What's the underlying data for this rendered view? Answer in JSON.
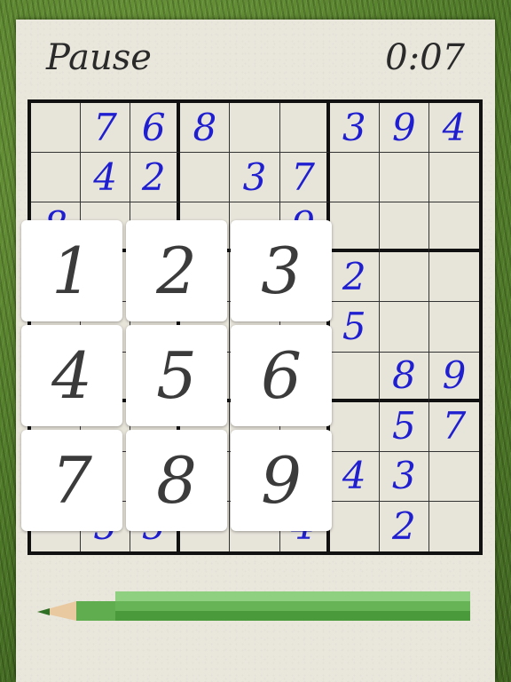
{
  "header": {
    "pause_label": "Pause",
    "timer": "0:07"
  },
  "grid": {
    "rows": [
      [
        "",
        "7",
        "6",
        "8",
        "",
        "",
        "3",
        "9",
        "4"
      ],
      [
        "",
        "4",
        "2",
        "",
        "3",
        "7",
        "",
        "",
        ""
      ],
      [
        "8",
        "",
        "",
        "",
        "",
        "9",
        "",
        "",
        ""
      ],
      [
        "",
        "",
        "",
        "",
        "",
        "",
        "2",
        "",
        ""
      ],
      [
        "",
        "",
        "",
        "",
        "",
        "",
        "5",
        "",
        ""
      ],
      [
        "",
        "",
        "",
        "",
        "",
        "",
        "",
        "8",
        "9"
      ],
      [
        "",
        "",
        "",
        "",
        "",
        "",
        "",
        "5",
        "7"
      ],
      [
        "",
        "",
        "",
        "",
        "",
        "",
        "4",
        "3",
        ""
      ],
      [
        "",
        "5",
        "5",
        "",
        "",
        "4",
        "",
        "2",
        ""
      ]
    ],
    "digit_color": "#1f1fd0"
  },
  "keypad": {
    "keys": [
      "1",
      "2",
      "3",
      "4",
      "5",
      "6",
      "7",
      "8",
      "9"
    ]
  },
  "pencil": {
    "icon": "pencil-icon",
    "color": "#5fad4f"
  }
}
